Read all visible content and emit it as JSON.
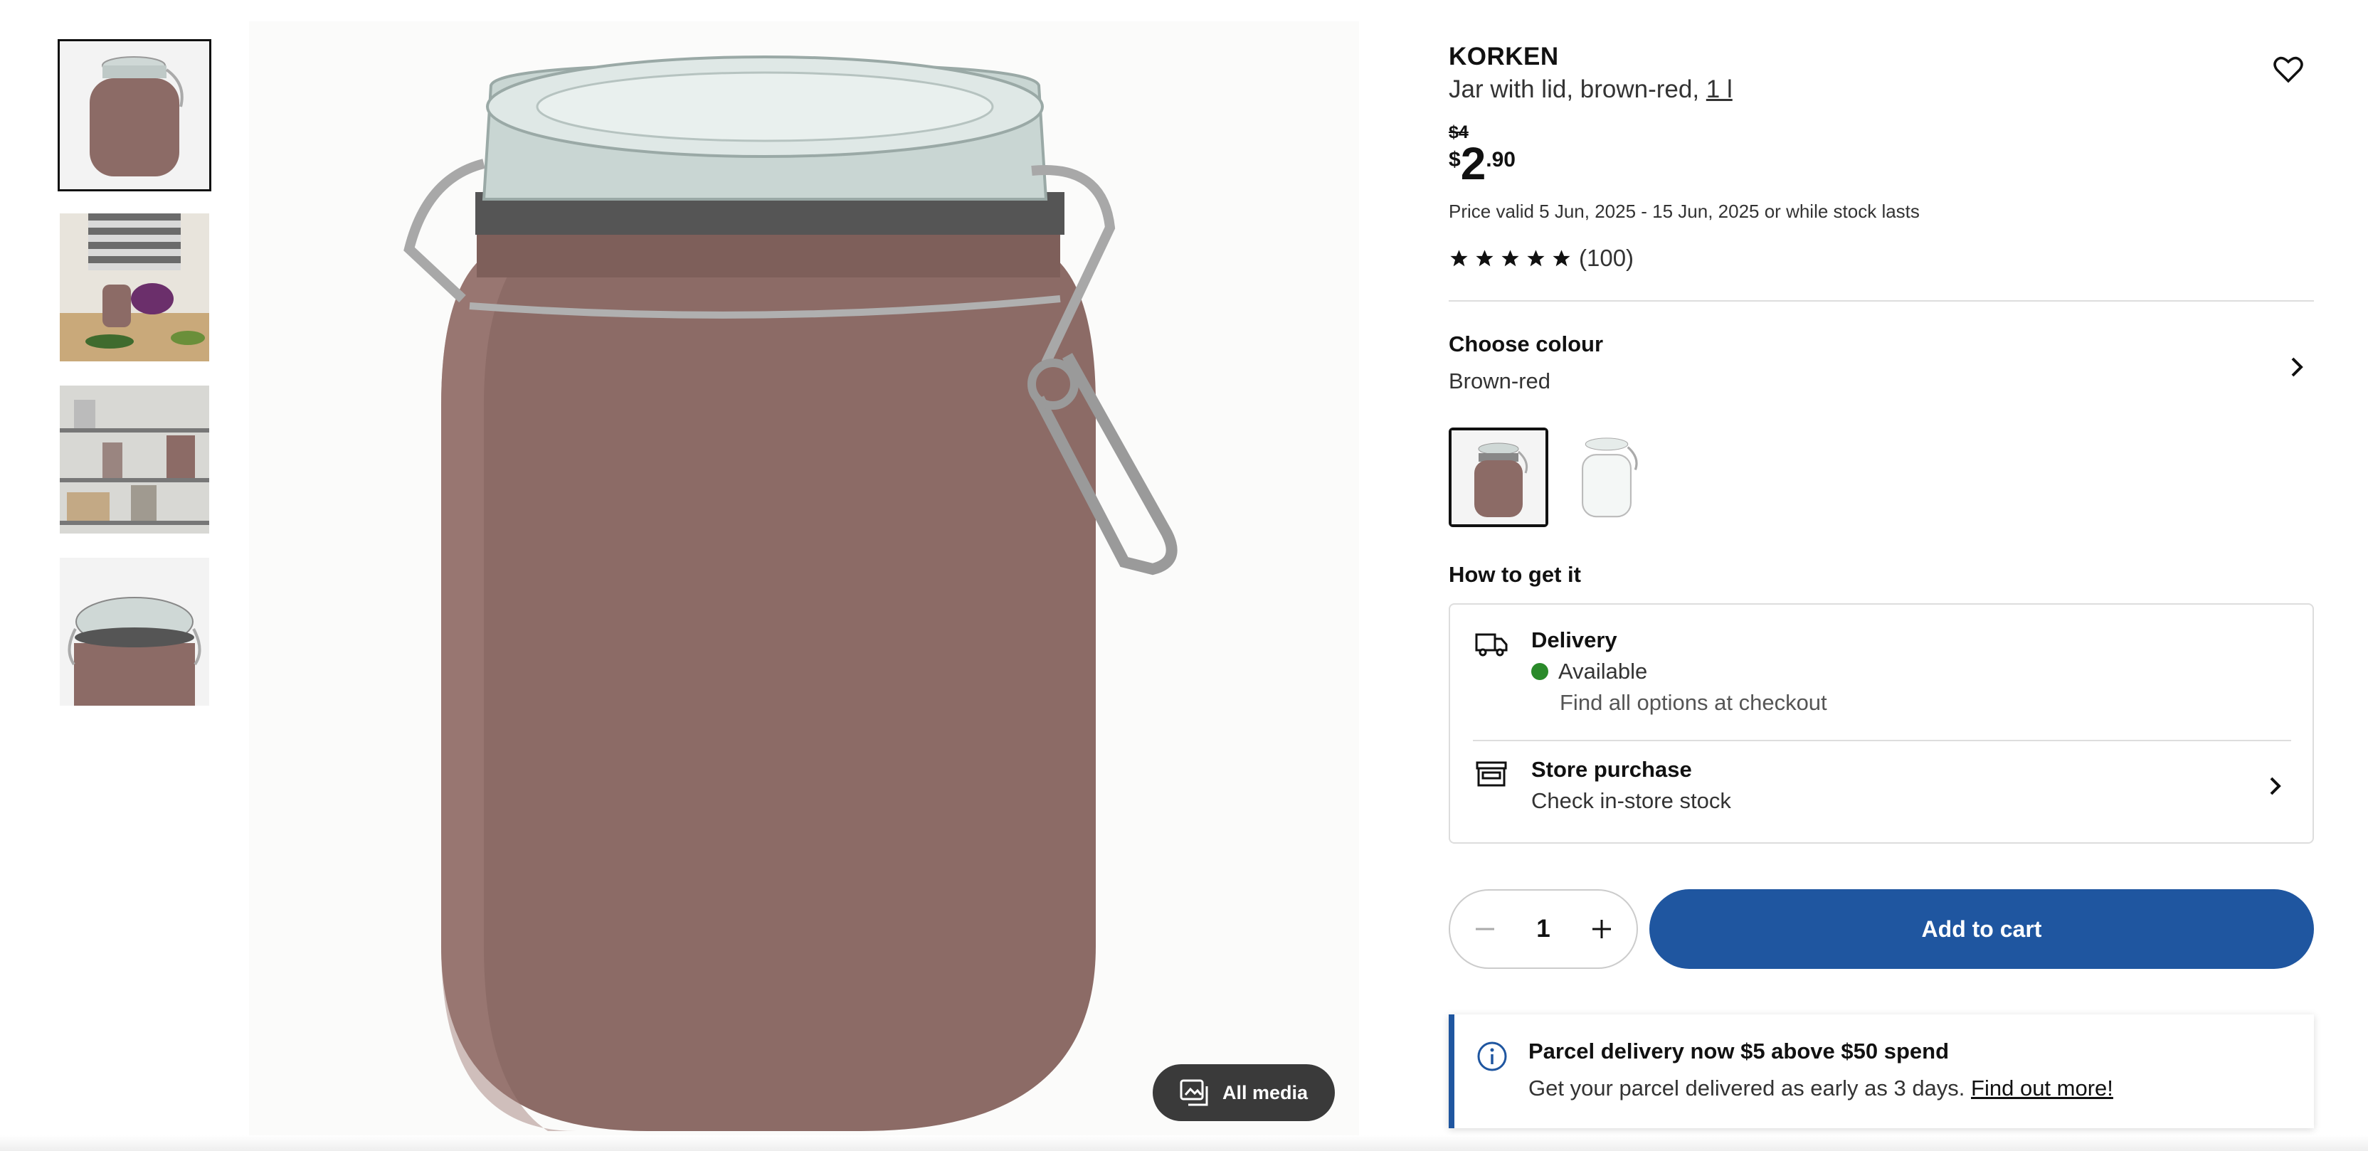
{
  "product": {
    "brand": "KORKEN",
    "description": "Jar with lid, brown-red, ",
    "size": "1 l",
    "old_price": "$4",
    "price_currency": "$",
    "price_integer": "2",
    "price_decimal": ".90",
    "price_valid": "Price valid 5 Jun, 2025 - 15 Jun, 2025 or while stock lasts",
    "rating_count": "(100)",
    "rating_value": 5
  },
  "colour": {
    "title": "Choose colour",
    "selected": "Brown-red",
    "swatches": [
      "brown-red",
      "clear-glass"
    ]
  },
  "how_to_get": {
    "title": "How to get it",
    "delivery_title": "Delivery",
    "delivery_status": "Available",
    "delivery_note": "Find all options at checkout",
    "store_title": "Store purchase",
    "store_note": "Check in-store stock"
  },
  "cart": {
    "quantity": "1",
    "add_label": "Add to cart"
  },
  "banner": {
    "title": "Parcel delivery now $5 above $50 spend",
    "text": "Get your parcel delivered as early as 3 days. ",
    "link": "Find out more!"
  },
  "media": {
    "all_media_label": "All media",
    "thumbnails": [
      "jar-front",
      "kitchen-prep",
      "pantry-shelf",
      "jar-top"
    ]
  },
  "colors": {
    "jar": "#8c6b66",
    "accent_blue": "#1f56a0",
    "available_green": "#2a8a2a"
  }
}
